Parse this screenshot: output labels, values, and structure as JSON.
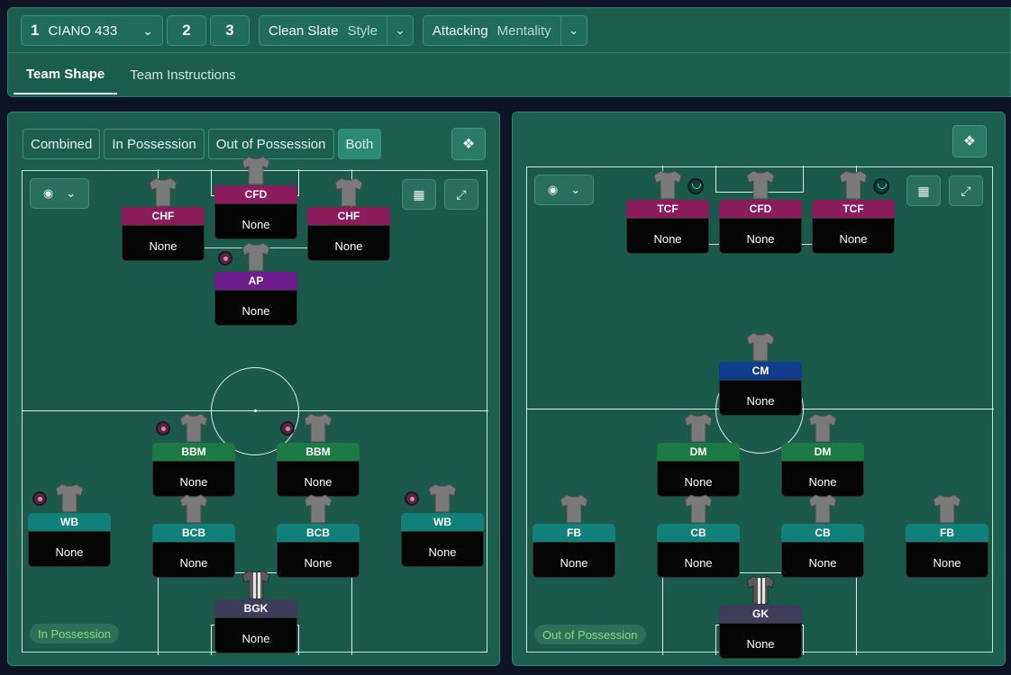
{
  "tactic": {
    "slot1_number": "1",
    "slot1_name": "CIANO 433",
    "slot2": "2",
    "slot3": "3",
    "style_value": "Clean Slate",
    "style_label": "Style",
    "mentality_value": "Attacking",
    "mentality_label": "Mentality"
  },
  "tabs": [
    "Team Shape",
    "Team Instructions"
  ],
  "modes": [
    "Combined",
    "In Possession",
    "Out of Possession",
    "Both"
  ],
  "left_phase": "In Possession",
  "right_phase": "Out of Possession",
  "players_left": [
    {
      "role": "CFD",
      "name": "None",
      "color": "#8c1d5c"
    },
    {
      "role": "CHF",
      "name": "None",
      "color": "#8c1d5c"
    },
    {
      "role": "CHF",
      "name": "None",
      "color": "#8c1d5c"
    },
    {
      "role": "AP",
      "name": "None",
      "color": "#6e1d8c"
    },
    {
      "role": "BBM",
      "name": "None",
      "color": "#1d7a44"
    },
    {
      "role": "BBM",
      "name": "None",
      "color": "#1d7a44"
    },
    {
      "role": "WB",
      "name": "None",
      "color": "#12807a"
    },
    {
      "role": "BCB",
      "name": "None",
      "color": "#12807a"
    },
    {
      "role": "BCB",
      "name": "None",
      "color": "#12807a"
    },
    {
      "role": "WB",
      "name": "None",
      "color": "#12807a"
    },
    {
      "role": "BGK",
      "name": "None",
      "color": "#3f3d5c"
    }
  ],
  "players_right": [
    {
      "role": "TCF",
      "name": "None",
      "color": "#8c1d5c"
    },
    {
      "role": "CFD",
      "name": "None",
      "color": "#8c1d5c"
    },
    {
      "role": "TCF",
      "name": "None",
      "color": "#8c1d5c"
    },
    {
      "role": "CM",
      "name": "None",
      "color": "#123c8c"
    },
    {
      "role": "DM",
      "name": "None",
      "color": "#1d7a44"
    },
    {
      "role": "DM",
      "name": "None",
      "color": "#1d7a44"
    },
    {
      "role": "FB",
      "name": "None",
      "color": "#12807a"
    },
    {
      "role": "CB",
      "name": "None",
      "color": "#12807a"
    },
    {
      "role": "CB",
      "name": "None",
      "color": "#12807a"
    },
    {
      "role": "FB",
      "name": "None",
      "color": "#12807a"
    },
    {
      "role": "GK",
      "name": "None",
      "color": "#3f3d5c"
    }
  ]
}
